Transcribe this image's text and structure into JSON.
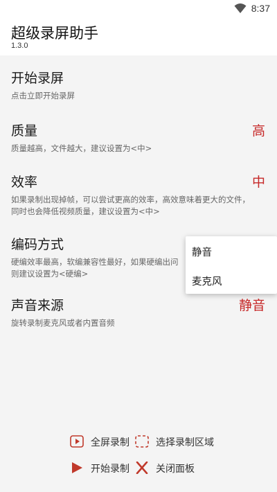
{
  "status_bar": {
    "time": "8:37",
    "icons": [
      "wifi-icon"
    ]
  },
  "app": {
    "title": "超级录屏助手",
    "version": "1.3.0"
  },
  "settings": [
    {
      "title": "开始录屏",
      "value": "",
      "description": "点击立即开始录屏"
    },
    {
      "title": "质量",
      "value": "高",
      "description": "质量越高，文件越大，建议设置为<中>"
    },
    {
      "title": "效率",
      "value": "中",
      "description_lines": [
        "如果录制出现掉帧，可以尝试更高的效率，高效意味着更大的文件，",
        "同时也会降低视频质量，建议设置为<中>"
      ]
    },
    {
      "title": "编码方式",
      "value": "",
      "description_lines": [
        "硬编效率最高，软编兼容性最好，如果硬编出问",
        "则建议设置为<硬编>"
      ]
    },
    {
      "title": "声音来源",
      "value": "静音",
      "description": "旋转录制麦克风或者内置音频"
    }
  ],
  "sound_menu": {
    "options": [
      "静音",
      "麦克风"
    ]
  },
  "controls": {
    "fullscreen_label": "全屏录制",
    "select_region_label": "选择录制区域",
    "start_label": "开始录制",
    "close_label": "关闭面板"
  },
  "colors": {
    "accent": "#c62828",
    "background": "#f4f4f4"
  }
}
